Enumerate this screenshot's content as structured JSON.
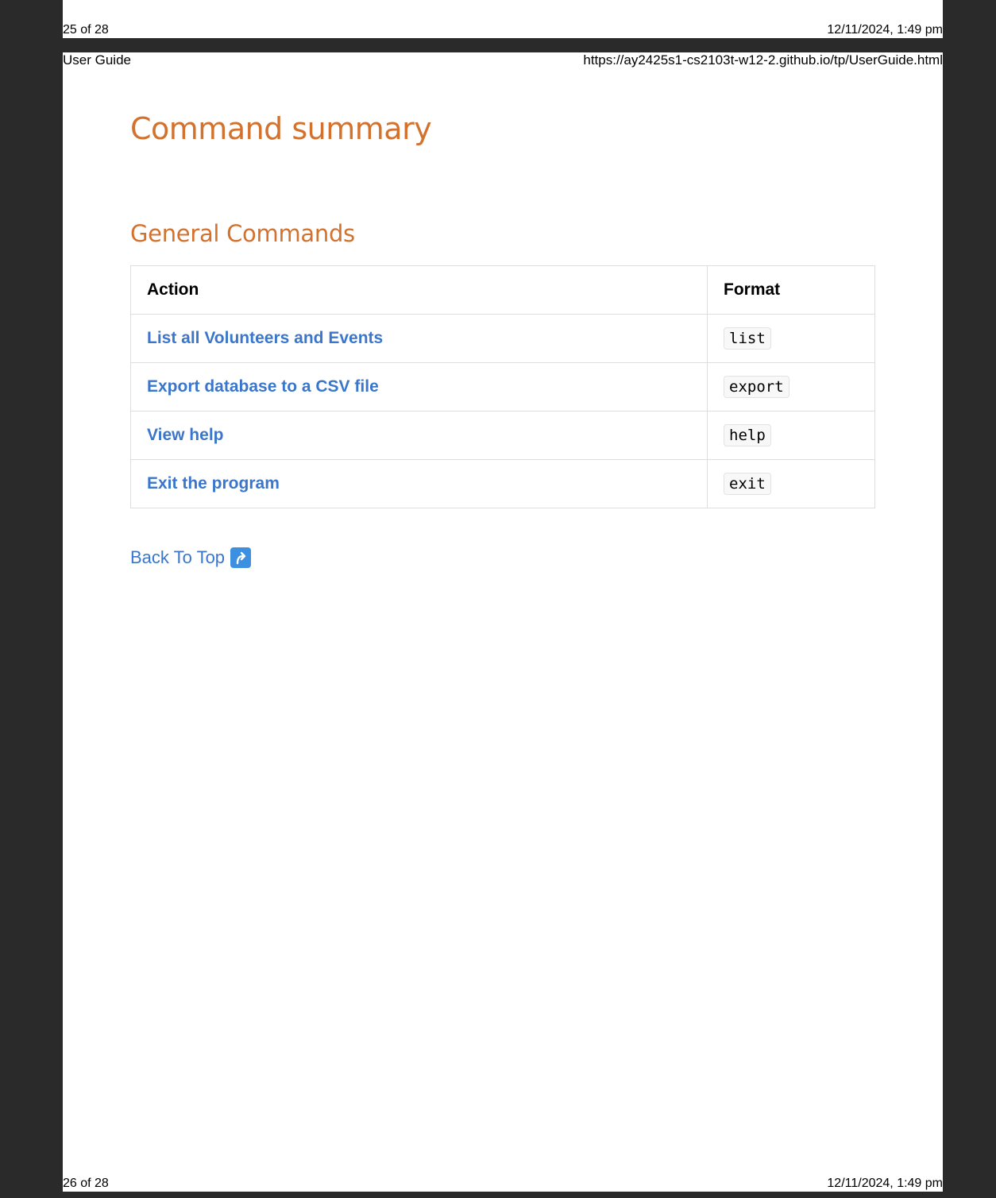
{
  "print_header_top": {
    "page_count": "25 of 28",
    "datetime": "12/11/2024, 1:49 pm"
  },
  "print_header": {
    "doc_title": "User Guide",
    "url": "https://ay2425s1-cs2103t-w12-2.github.io/tp/UserGuide.html"
  },
  "print_footer": {
    "page_count": "26 of 28",
    "datetime": "12/11/2024, 1:49 pm"
  },
  "main": {
    "title": "Command summary",
    "section_title": "General Commands",
    "table": {
      "headers": [
        "Action",
        "Format"
      ],
      "rows": [
        {
          "action": "List all Volunteers and Events",
          "format": "list"
        },
        {
          "action": "Export database to a CSV file",
          "format": "export"
        },
        {
          "action": "View help",
          "format": "help"
        },
        {
          "action": "Exit the program",
          "format": "exit"
        }
      ]
    },
    "back_to_top": "Back To Top",
    "back_to_top_icon": "up-arrow-icon"
  },
  "colors": {
    "heading": "#d2722e",
    "link": "#3a76cc",
    "viewer_bg": "#2a2a2a"
  }
}
